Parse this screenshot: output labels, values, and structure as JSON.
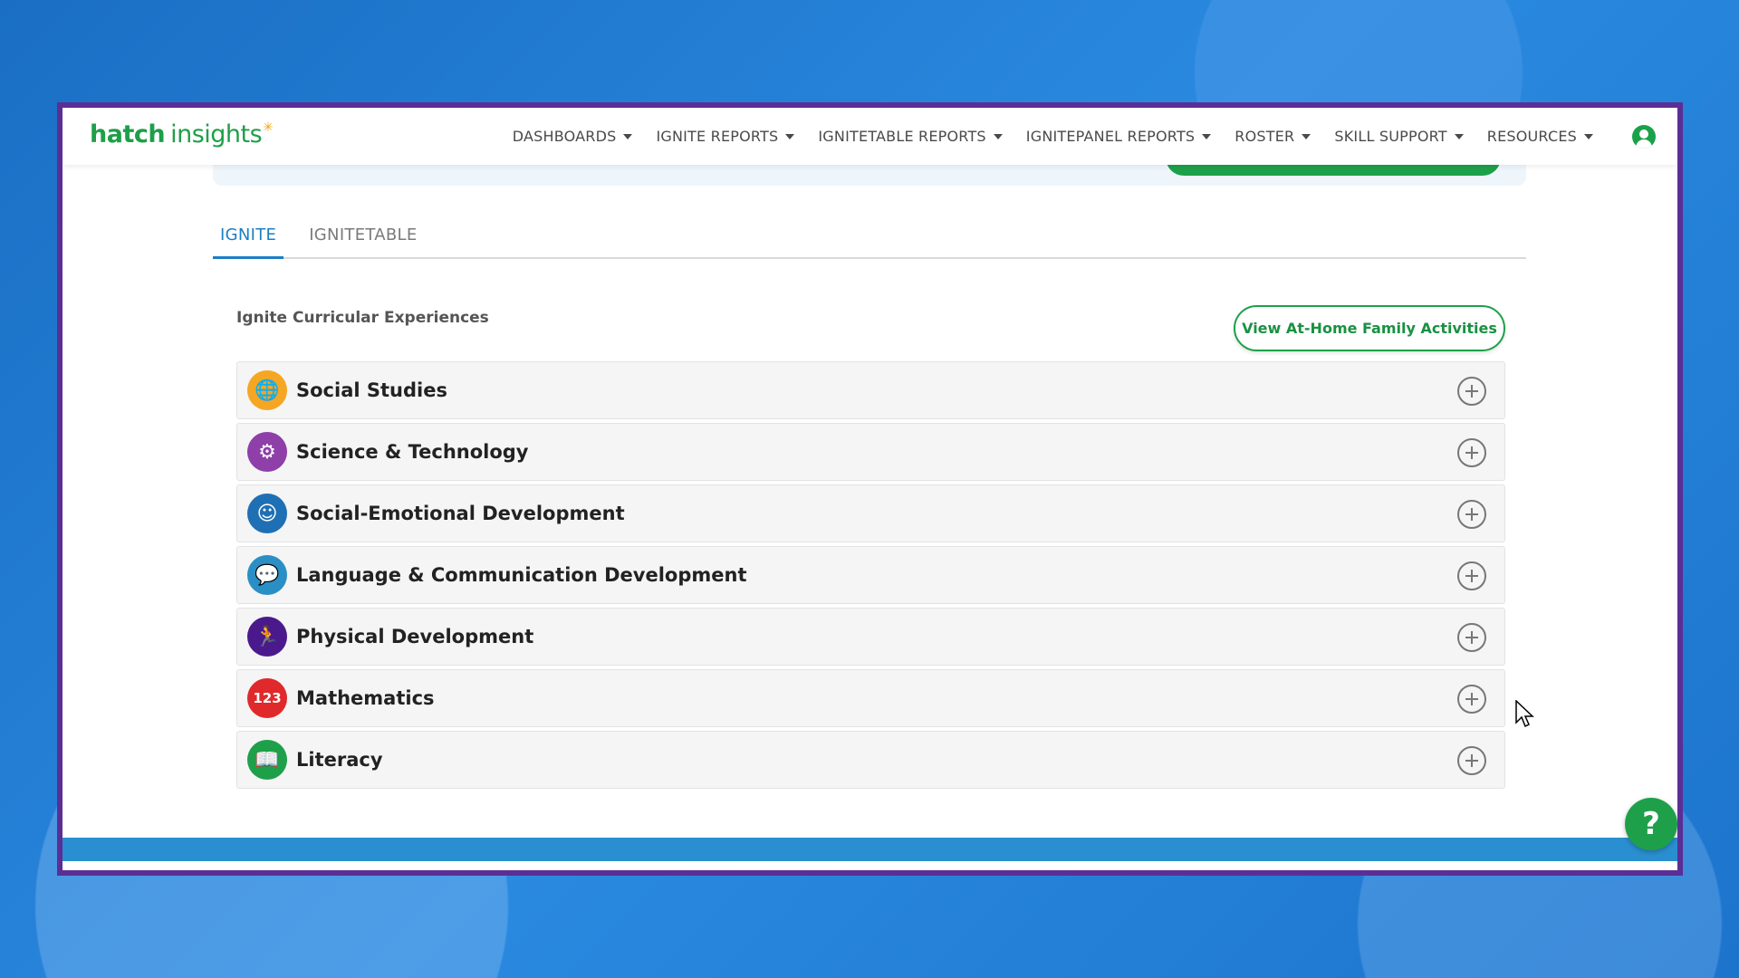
{
  "brand": {
    "name_bold": "hatch",
    "name_regular": "insights",
    "accent": "#1ea04a",
    "primary": "#1b7fc4",
    "frame": "#5b2e95"
  },
  "navbar": {
    "items": [
      {
        "label": "DASHBOARDS"
      },
      {
        "label": "IGNITE REPORTS"
      },
      {
        "label": "IGNITETABLE REPORTS"
      },
      {
        "label": "IGNITEPANEL REPORTS"
      },
      {
        "label": "ROSTER"
      },
      {
        "label": "SKILL SUPPORT"
      },
      {
        "label": "RESOURCES"
      }
    ],
    "profile_icon": "user-icon"
  },
  "tabs": [
    {
      "label": "IGNITE",
      "active": true
    },
    {
      "label": "IGNITETABLE",
      "active": false
    }
  ],
  "section": {
    "title": "Ignite Curricular Experiences",
    "family_button": "View At-Home Family Activities"
  },
  "accordion": [
    {
      "label": "Social Studies",
      "icon": "globe-icon",
      "glyph": "🌐",
      "color": "#f5a623"
    },
    {
      "label": "Science & Technology",
      "icon": "gears-icon",
      "glyph": "⚙",
      "color": "#8e3fa8"
    },
    {
      "label": "Social-Emotional Development",
      "icon": "faces-icon",
      "glyph": "☺",
      "color": "#1f6fb5"
    },
    {
      "label": "Language & Communication Development",
      "icon": "speech-bubble-icon",
      "glyph": "💬",
      "color": "#2a8fc4"
    },
    {
      "label": "Physical Development",
      "icon": "running-figure-icon",
      "glyph": "🏃",
      "color": "#4a1a8c"
    },
    {
      "label": "Mathematics",
      "icon": "numbers-icon",
      "glyph": "123",
      "color": "#e0292b"
    },
    {
      "label": "Literacy",
      "icon": "book-icon",
      "glyph": "📖",
      "color": "#1ea04a"
    }
  ],
  "help": {
    "label": "?"
  }
}
